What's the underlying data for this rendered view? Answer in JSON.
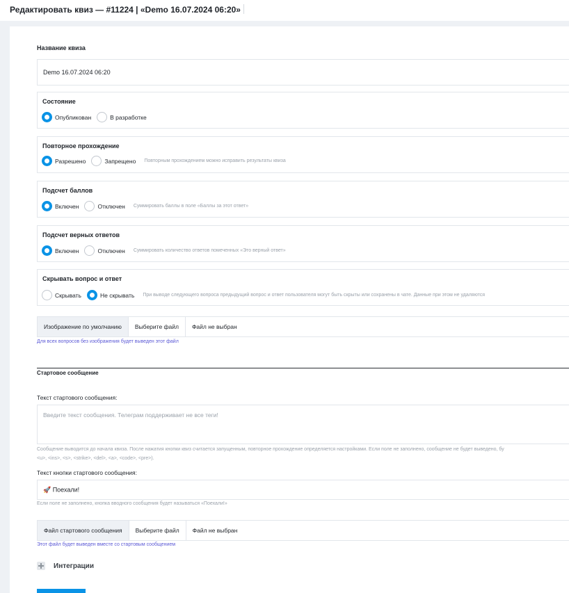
{
  "header": {
    "title": "Редактировать квиз — #11224 | «Demo 16.07.2024 06:20»"
  },
  "quiz_name": {
    "label": "Название квиза",
    "value": "Demo 16.07.2024 06:20"
  },
  "state": {
    "title": "Состояние",
    "options": [
      "Опубликован",
      "В разработке"
    ],
    "selected": "Опубликован"
  },
  "retake": {
    "title": "Повторное прохождение",
    "options": [
      "Разрешено",
      "Запрещено"
    ],
    "selected": "Разрешено",
    "hint": "Повторным прохождением можно исправить результаты квиза"
  },
  "scoring": {
    "title": "Подсчет баллов",
    "options": [
      "Включен",
      "Отключен"
    ],
    "selected": "Включен",
    "hint": "Суммировать баллы в поле «Баллы за этот ответ»"
  },
  "correct_count": {
    "title": "Подсчет верных ответов",
    "options": [
      "Включен",
      "Отключен"
    ],
    "selected": "Включен",
    "hint": "Суммировать количество ответов помеченных «Это верный ответ»"
  },
  "hide_qa": {
    "title": "Скрывать вопрос и ответ",
    "options": [
      "Скрывать",
      "Не скрывать"
    ],
    "selected": "Не скрывать",
    "hint": "При выводе следующего вопроса предыдущий вопрос и ответ пользователя могут быть скрыты или сохранены в чате. Данные при этом не удаляются"
  },
  "default_image": {
    "label": "Изображение по умолчанию",
    "button": "Выберите файл",
    "status": "Файл не выбран",
    "help": "Для всех вопросов без изображения будет выведен этот файл"
  },
  "start_message": {
    "section_title": "Стартовое сообщение",
    "text_label": "Текст стартового сообщения:",
    "text_placeholder": "Введите текст сообщения. Телеграм поддерживает не все теги!",
    "text_help_line1": "Сообщение выводится до начала квиза. После нажатия кнопки квиз считается запущенным, повторное прохождение определяется настройками. Если поле не заполнено, сообщение не будет выведено, бу",
    "text_help_line2": "<u>, <ins>, <s>, <strike>, <del>, <a>, <code>, <pre>).",
    "button_label": "Текст кнопки стартового сообщения:",
    "button_value": "🚀 Поехали!",
    "button_help": "Если поле не заполнено, кнопка вводного сообщения будет называться «Поехали!»",
    "file_label": "Файл стартового сообщения",
    "file_button": "Выберите файл",
    "file_status": "Файл не выбран",
    "file_help": "Этот файл будет выведен вместе со стартовым сообщением"
  },
  "integrations": {
    "label": "Интеграции"
  },
  "colors": {
    "accent": "#0a93e6",
    "link": "#5b59d6",
    "hint": "#9aa1aa",
    "background": "#eef1f5"
  }
}
